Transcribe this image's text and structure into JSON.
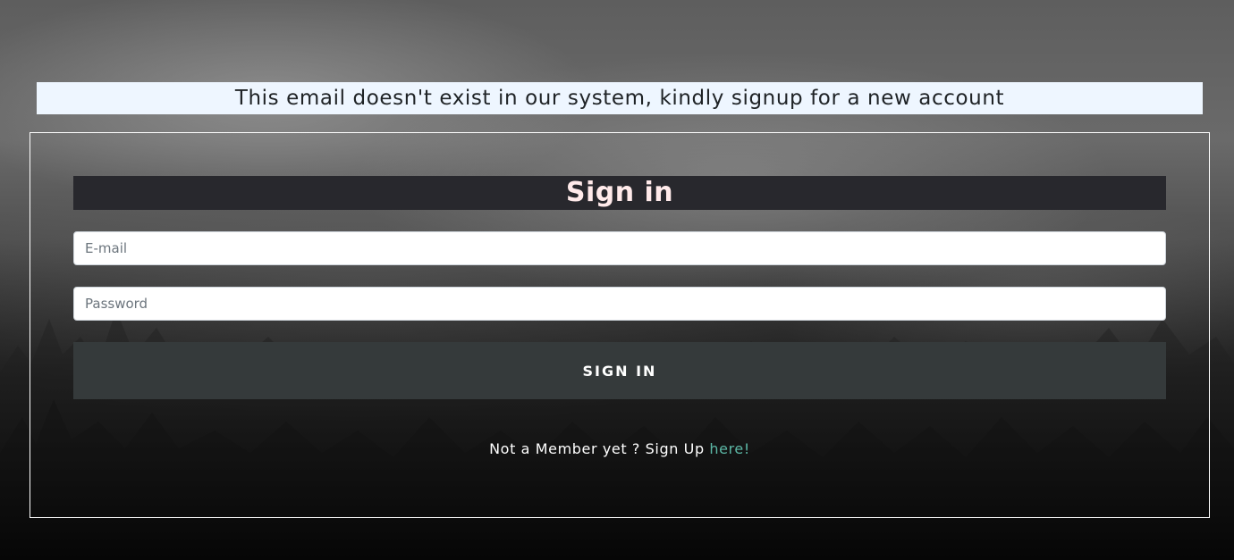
{
  "alert": {
    "message": "This email doesn't exist in our system, kindly signup for a new account"
  },
  "form": {
    "title": "Sign in",
    "email_placeholder": "E-mail",
    "password_placeholder": "Password",
    "submit_label": "SIGN IN"
  },
  "footer": {
    "prompt": "Not a Member yet ? Sign Up ",
    "link_label": "here!"
  },
  "colors": {
    "title_bar_bg": "#28282d",
    "title_text": "#ffeaea",
    "button_bg": "#353a3b",
    "alert_bg": "#eef6ff",
    "link": "#5cb8a6"
  }
}
